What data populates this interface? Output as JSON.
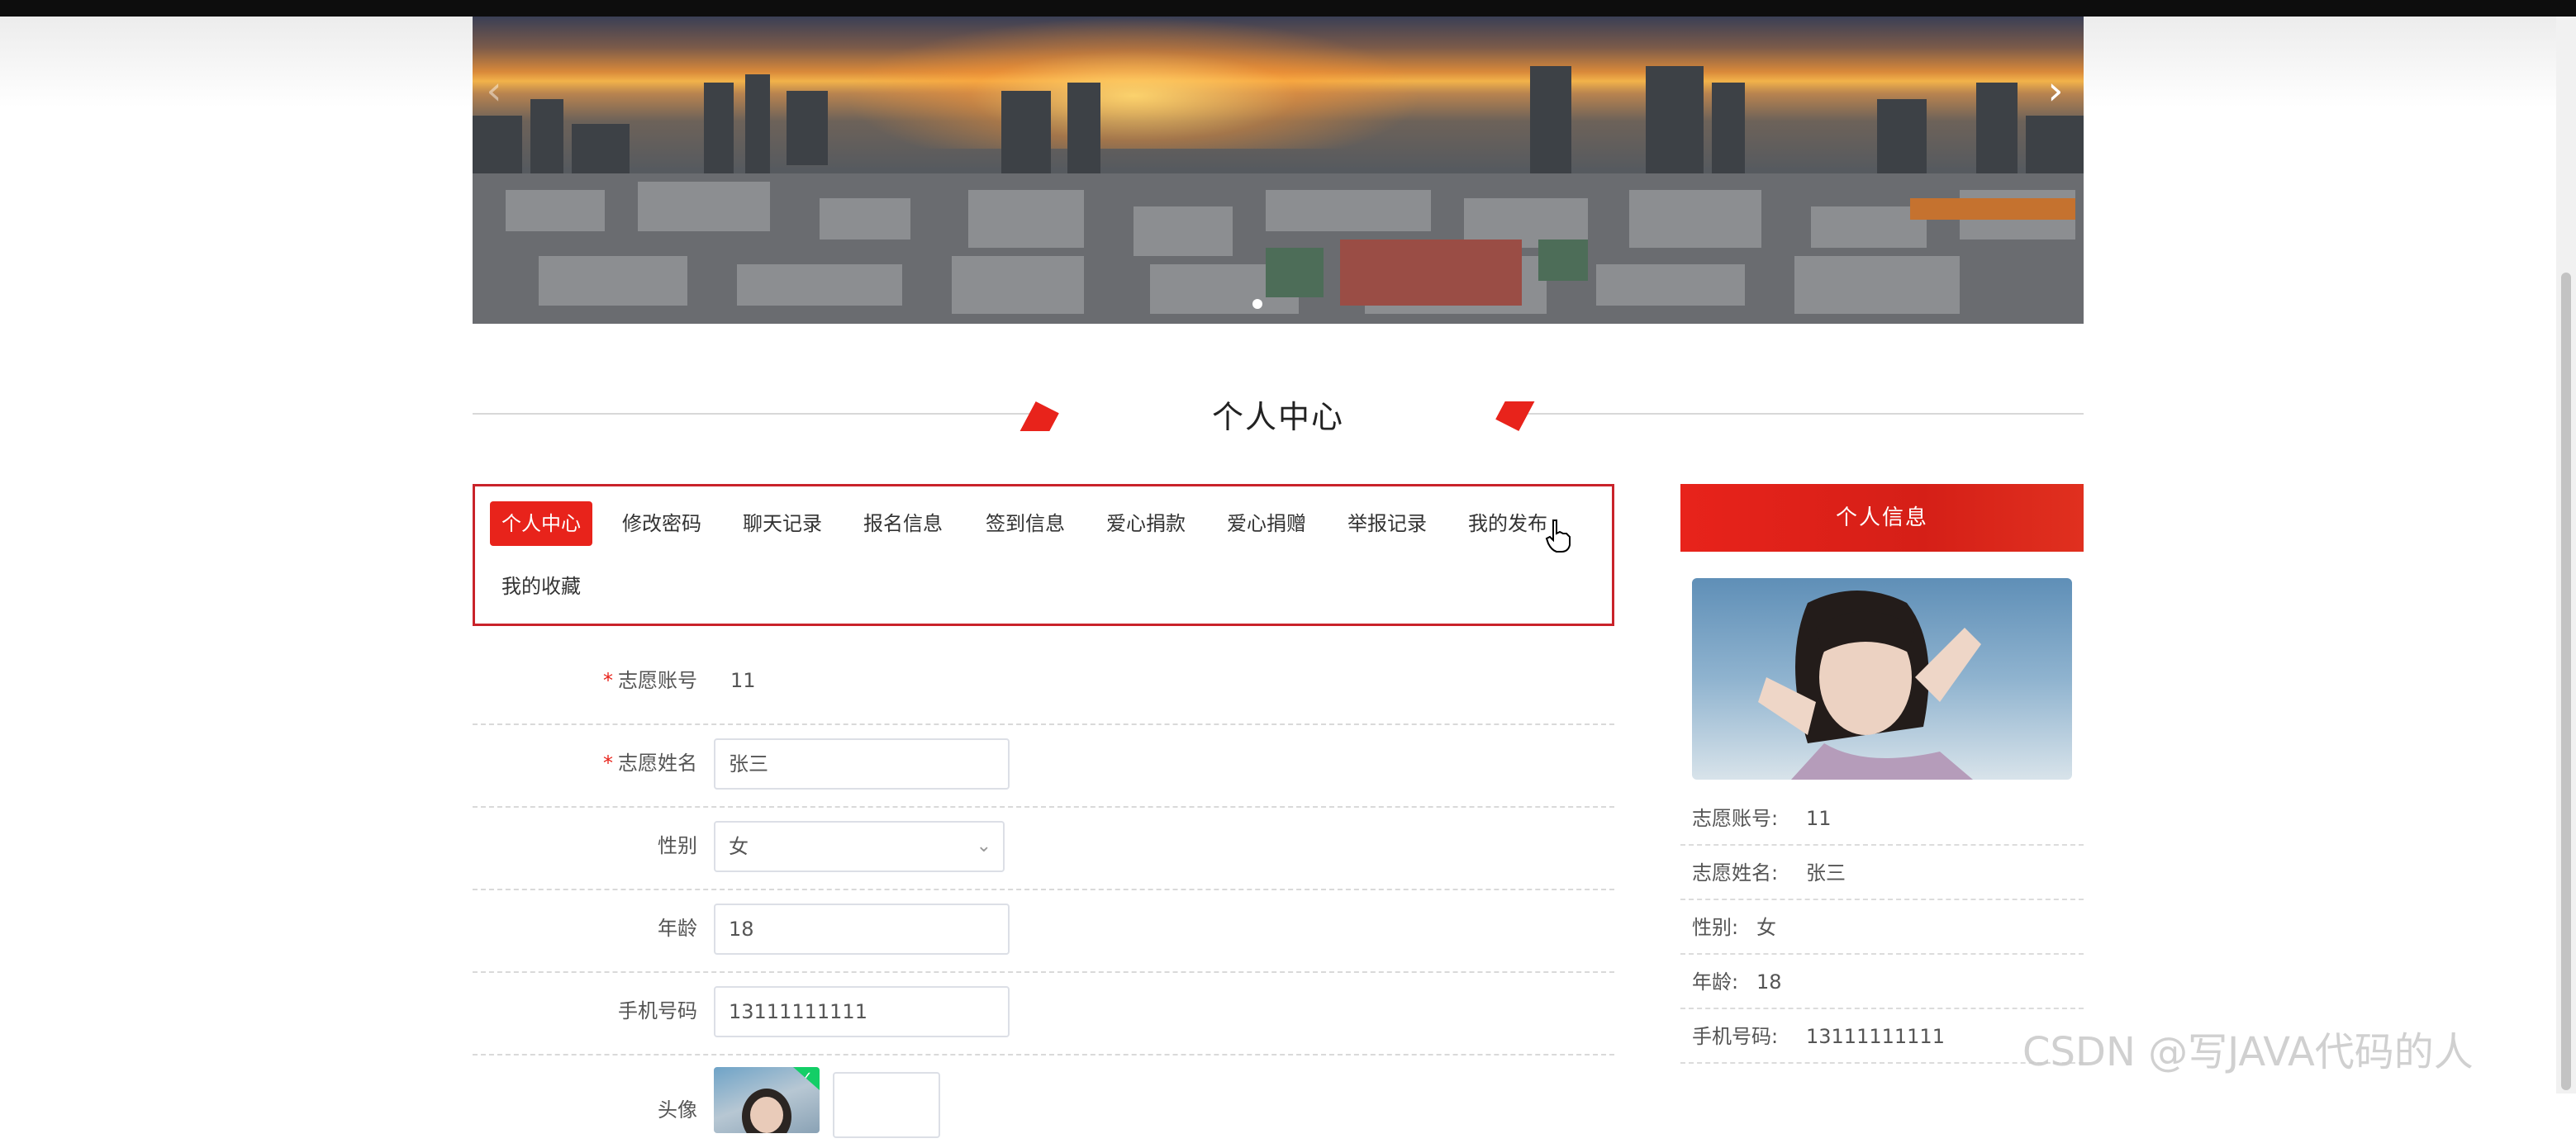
{
  "banner": {
    "prev_icon": "chevron-left",
    "next_icon": "chevron-right",
    "prev_glyph": "‹",
    "next_glyph": "›",
    "slide_index": 1
  },
  "section": {
    "title": "个人中心"
  },
  "tabs": [
    {
      "label": "个人中心",
      "active": true
    },
    {
      "label": "修改密码",
      "active": false
    },
    {
      "label": "聊天记录",
      "active": false
    },
    {
      "label": "报名信息",
      "active": false
    },
    {
      "label": "签到信息",
      "active": false
    },
    {
      "label": "爱心捐款",
      "active": false
    },
    {
      "label": "爱心捐赠",
      "active": false
    },
    {
      "label": "举报记录",
      "active": false
    },
    {
      "label": "我的发布",
      "active": false
    },
    {
      "label": "我的收藏",
      "active": false
    }
  ],
  "form": {
    "account": {
      "required_mark": "*",
      "label": "志愿账号",
      "value": "11"
    },
    "name": {
      "required_mark": "*",
      "label": "志愿姓名",
      "value": "张三"
    },
    "gender": {
      "label": "性别",
      "value": "女"
    },
    "age": {
      "label": "年龄",
      "value": "18"
    },
    "phone": {
      "label": "手机号码",
      "value": "13111111111"
    },
    "avatar": {
      "label": "头像"
    }
  },
  "side": {
    "title": "个人信息",
    "rows": [
      {
        "key": "志愿账号:",
        "value": "11"
      },
      {
        "key": "志愿姓名:",
        "value": "张三"
      },
      {
        "key": "性别:",
        "value": "女"
      },
      {
        "key": "年龄:",
        "value": "18"
      },
      {
        "key": "手机号码:",
        "value": "13111111111"
      }
    ]
  },
  "watermark": "CSDN @写JAVA代码的人",
  "colors": {
    "accent": "#e8231b",
    "border": "#c9232a"
  }
}
